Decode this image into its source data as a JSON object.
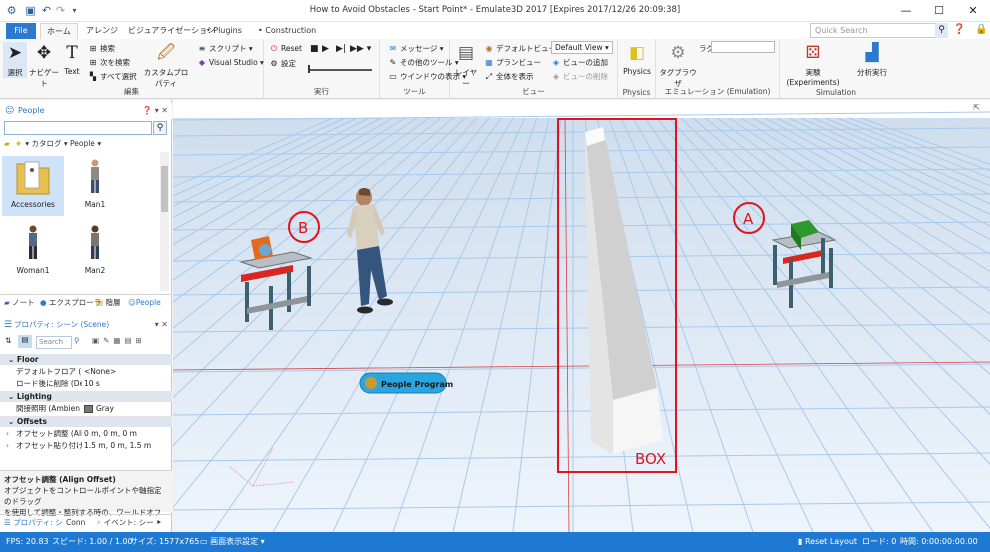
{
  "window": {
    "title": "How to Avoid Obstacles - Start Point* - Emulate3D 2017 [Expires 2017/12/26 20:09:38]",
    "minimize": "—",
    "maximize": "☐",
    "close": "✕"
  },
  "ribbon_tabs": {
    "file": "File",
    "home": "ホーム",
    "arrange": "アレンジ",
    "visualization": "ビジュアライゼーション",
    "plugins": "• Plugins",
    "construction": "• Construction",
    "search_placeholder": "Quick Search"
  },
  "ribbon": {
    "edit": {
      "label": "編集",
      "select": "選択",
      "navigate": "ナビゲート",
      "text": "Text",
      "search": "検索",
      "find_next": "次を検索",
      "select_all": "すべて選択",
      "custom_props": "カスタムプロパティ",
      "script": "スクリプト",
      "visual_studio": "Visual Studio"
    },
    "run": {
      "label": "実行",
      "reset": "Reset",
      "settings": "設定"
    },
    "tools": {
      "label": "ツール",
      "message": "メッセージ",
      "other_tools": "その他のツール",
      "window_display": "ウインドウの表示"
    },
    "view": {
      "label": "ビュー",
      "layer": "レイヤー",
      "default_view": "デフォルトビュー",
      "plan_view": "プランビュー",
      "show_all": "全体を表示",
      "view_dropdown": "Default View",
      "add_view": "ビューの追加",
      "delete_view": "ビューの削除"
    },
    "physics": {
      "label": "Physics",
      "physics": "Physics"
    },
    "emulation": {
      "label": "エミュレーション (Emulation)",
      "tag_browser": "タグブラウザ",
      "lag": "ラグ"
    },
    "simulation": {
      "label": "Simulation",
      "experiments": "実験 (Experiments)",
      "analysis": "分析実行"
    }
  },
  "people_panel": {
    "title": "People",
    "catalog": "カタログ",
    "people_filter": "People",
    "items": [
      "Accessories",
      "Man1",
      "Woman1",
      "Man2"
    ],
    "tabs": [
      "ノート",
      "エクスプローラ",
      "階層",
      "People"
    ]
  },
  "properties_panel": {
    "title": "プロパティ: シーン (Scene)",
    "search_placeholder": "Search",
    "sections": {
      "floor": "Floor",
      "lighting": "Lighting",
      "offsets": "Offsets"
    },
    "rows": {
      "default_floor_key": "デフォルトフロア (Def",
      "default_floor_val": "<None>",
      "delete_after_load_key": "ロード後に削除 (De",
      "delete_after_load_val": "10 s",
      "indirect_light_key": "間接照明 (Ambien",
      "indirect_light_val": "Gray",
      "offset_align_key": "オフセット調整 (Alig",
      "offset_align_val": "0 m, 0 m, 0 m",
      "offset_paste_key": "オフセット貼り付け (F",
      "offset_paste_val": "1.5 m, 0 m, 1.5 m"
    },
    "desc_title": "オフセット調整 (Align Offset)",
    "desc_text_1": "オブジェクトをコントロールポイントや軸指定のドラッグ",
    "desc_text_2": "を使用して調整・整列する時の、ワールドオフセット...",
    "bottom_tabs": [
      "プロパティ: シ",
      "Conn",
      "イベント: シー"
    ]
  },
  "scene": {
    "label_a": "A",
    "label_b": "B",
    "label_box": "BOX",
    "people_program": "People Program"
  },
  "status": {
    "fps": "FPS: 20.83",
    "speed": "スピード: 1.00 / 1.00",
    "size": "サイズ: 1577x765",
    "display_settings": "画面表示設定",
    "reset_layout": "Reset Layout",
    "load": "ロード: 0",
    "time": "時間: 0:00:00:00.00"
  },
  "colors": {
    "accent": "#1e79d2",
    "annotation_red": "#e0141e",
    "grid_line": "#a9c9ec",
    "floor": "#eaf1f9"
  }
}
